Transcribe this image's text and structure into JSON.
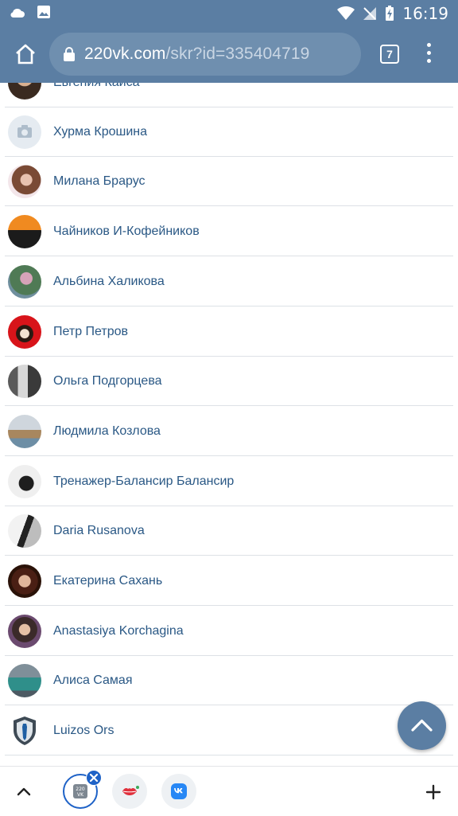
{
  "status": {
    "time": "16:19"
  },
  "browser": {
    "url_domain": "220vk.com",
    "url_path": "/skr?id=335404719",
    "tab_count": "7"
  },
  "friends": [
    {
      "name": "Евгения Кайса"
    },
    {
      "name": "Хурма Крошина"
    },
    {
      "name": "Милана Брарус"
    },
    {
      "name": "Чайников И-Кофейников"
    },
    {
      "name": "Альбина Халикова"
    },
    {
      "name": "Петр Петров"
    },
    {
      "name": "Ольга Подгорцева"
    },
    {
      "name": "Людмила Козлова"
    },
    {
      "name": "Тренажер-Балансир Балансир"
    },
    {
      "name": "Daria Rusanova"
    },
    {
      "name": "Екатерина Сахань"
    },
    {
      "name": "Anastasiya Korchagina"
    },
    {
      "name": "Алиса Самая"
    },
    {
      "name": "Luizos Ors"
    }
  ],
  "bottom_bar": {
    "app_badge_text": "220\nVK"
  },
  "colors": {
    "header": "#5b7ea3",
    "link": "#2a5885",
    "fab": "#5b7ea3"
  }
}
